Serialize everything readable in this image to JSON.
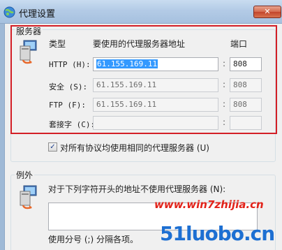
{
  "window": {
    "title": "代理设置",
    "close_glyph": "✕"
  },
  "servers": {
    "group_label": "服务器",
    "col_type": "类型",
    "col_address": "要使用的代理服务器地址",
    "col_port": "端口",
    "rows": [
      {
        "label": "HTTP (H):",
        "address": "61.155.169.11",
        "port": "808",
        "enabled": true
      },
      {
        "label": "安全 (S):",
        "address": "61.155.169.11",
        "port": "808",
        "enabled": false
      },
      {
        "label": "FTP (F):",
        "address": "61.155.169.11",
        "port": "808",
        "enabled": false
      },
      {
        "label": "套接字 (C):",
        "address": "",
        "port": "",
        "enabled": false
      }
    ],
    "same_proxy_label": "对所有协议均使用相同的代理服务器 (U)",
    "same_proxy_checked": true
  },
  "exceptions": {
    "group_label": "例外",
    "description": "对于下列字符开头的地址不使用代理服务器 (N):",
    "value": "",
    "hint": "使用分号 (;) 分隔各项。"
  },
  "watermarks": {
    "site1": "www.win7zhijia.cn",
    "site2": "51luobo.cn"
  },
  "colors": {
    "highlight": "#d31f26",
    "selection": "#3399ff",
    "titlebar": "#b3cbe6"
  }
}
